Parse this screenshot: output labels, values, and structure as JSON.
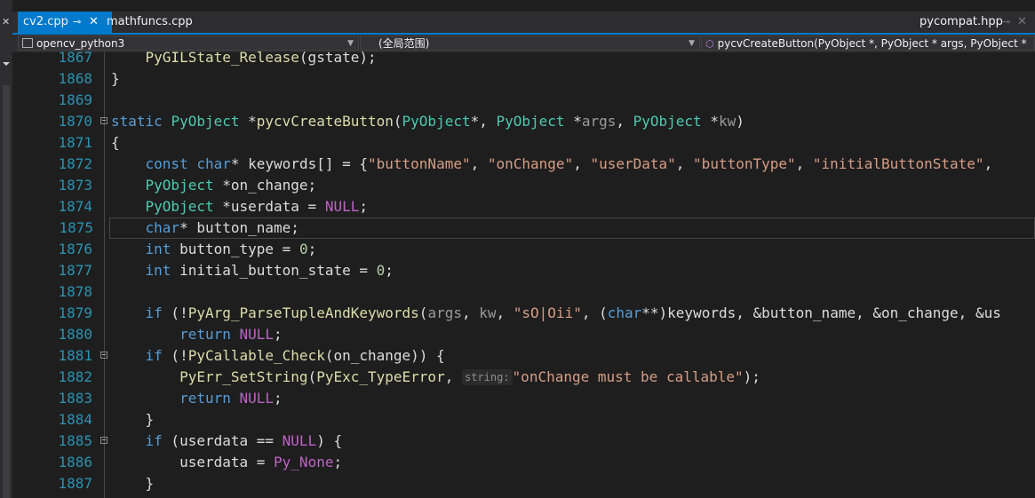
{
  "tabs": [
    {
      "label": "cv2.cpp",
      "active": true
    },
    {
      "label": "mathfuncs.cpp",
      "active": false
    },
    {
      "label": "pycompat.hpp",
      "active": false
    }
  ],
  "nav": {
    "project": "opencv_python3",
    "scope": "(全局范围)",
    "member": "pycvCreateButton(PyObject *, PyObject * args, PyObject * kv"
  },
  "lines": [
    {
      "n": "1867",
      "text": "    PyGILState_Release(gstate);"
    },
    {
      "n": "1868",
      "text": "}"
    },
    {
      "n": "1869",
      "text": ""
    },
    {
      "n": "1870",
      "text": "static PyObject *pycvCreateButton(PyObject*, PyObject *args, PyObject *kw)"
    },
    {
      "n": "1871",
      "text": "{"
    },
    {
      "n": "1872",
      "text": "    const char* keywords[] = {\"buttonName\", \"onChange\", \"userData\", \"buttonType\", \"initialButtonState\","
    },
    {
      "n": "1873",
      "text": "    PyObject *on_change;"
    },
    {
      "n": "1874",
      "text": "    PyObject *userdata = NULL;"
    },
    {
      "n": "1875",
      "text": "    char* button_name;"
    },
    {
      "n": "1876",
      "text": "    int button_type = 0;"
    },
    {
      "n": "1877",
      "text": "    int initial_button_state = 0;"
    },
    {
      "n": "1878",
      "text": ""
    },
    {
      "n": "1879",
      "text": "    if (!PyArg_ParseTupleAndKeywords(args, kw, \"sO|Oii\", (char**)keywords, &button_name, &on_change, &us"
    },
    {
      "n": "1880",
      "text": "        return NULL;"
    },
    {
      "n": "1881",
      "text": "    if (!PyCallable_Check(on_change)) {"
    },
    {
      "n": "1882",
      "text": "        PyErr_SetString(PyExc_TypeError, string:\"onChange must be callable\");"
    },
    {
      "n": "1883",
      "text": "        return NULL;"
    },
    {
      "n": "1884",
      "text": "    }"
    },
    {
      "n": "1885",
      "text": "    if (userdata == NULL) {"
    },
    {
      "n": "1886",
      "text": "        userdata = Py_None;"
    },
    {
      "n": "1887",
      "text": "    }"
    }
  ],
  "inlay_hint": "string:"
}
